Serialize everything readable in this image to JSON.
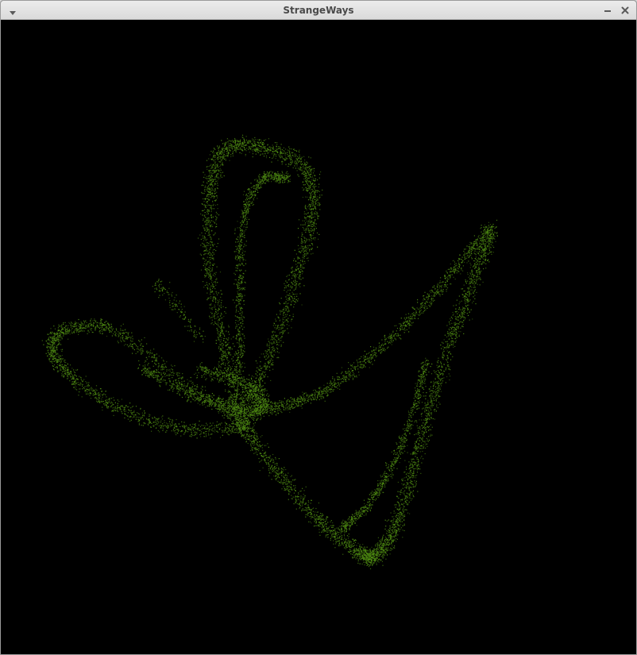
{
  "window": {
    "title": "StrangeWays"
  },
  "icons": {
    "menu": "chevron-down-icon",
    "minimize": "minimize-icon",
    "close": "close-icon"
  },
  "attractor": {
    "point_color": "#4e8a12",
    "background_color": "#000000"
  }
}
